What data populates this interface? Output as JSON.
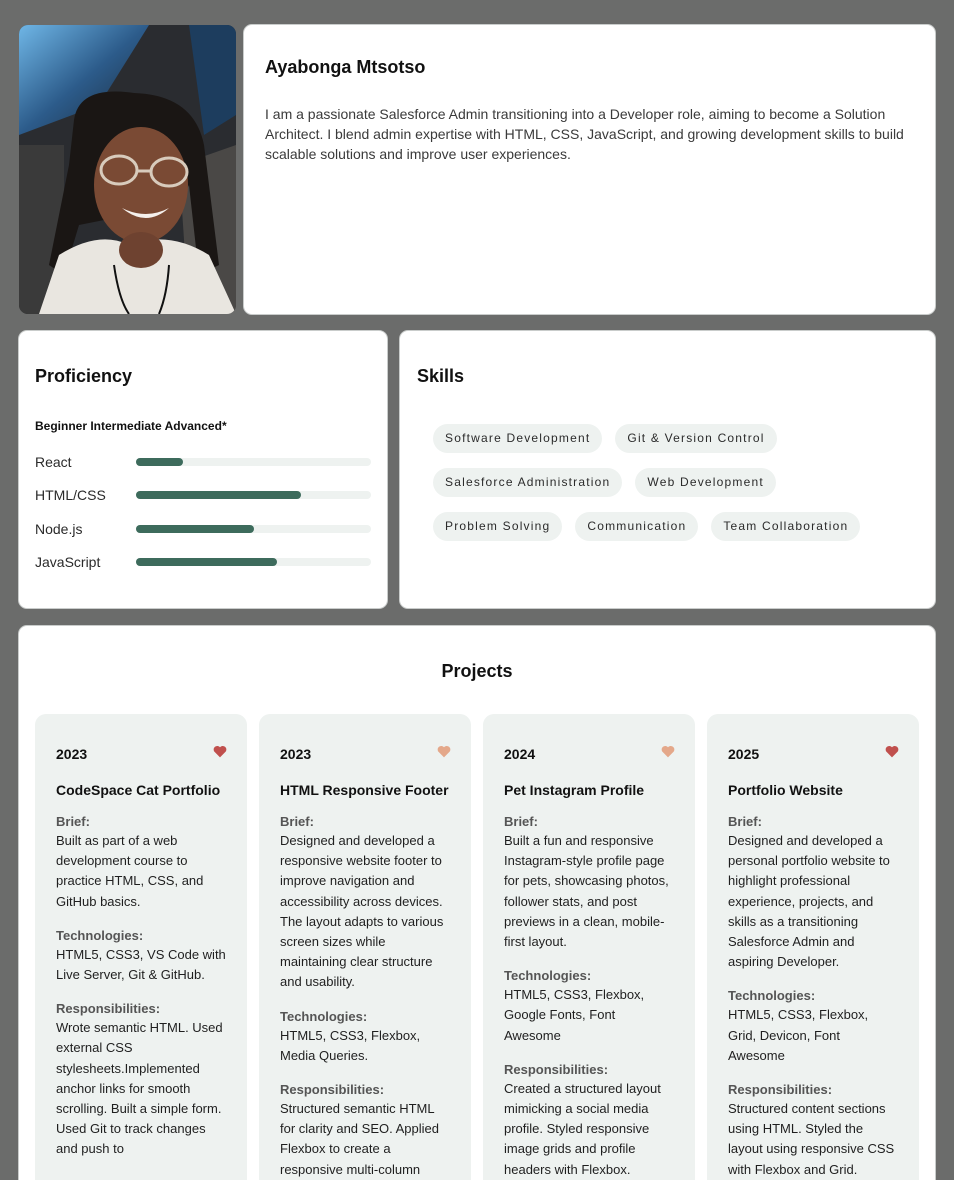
{
  "profile": {
    "name": "Ayabonga Mtsotso",
    "bio": "I am a passionate Salesforce Admin transitioning into a Developer role, aiming to become a Solution Architect. I blend admin expertise with HTML, CSS, JavaScript, and growing development skills to build scalable solutions and improve user experiences."
  },
  "proficiency": {
    "title": "Proficiency",
    "legend": "Beginner Intermediate Advanced*",
    "items": [
      {
        "label": "React",
        "level": 0.2
      },
      {
        "label": "HTML/CSS",
        "level": 0.7
      },
      {
        "label": "Node.js",
        "level": 0.5
      },
      {
        "label": "JavaScript",
        "level": 0.6
      }
    ],
    "bar_color": "#3d6b5c"
  },
  "skills": {
    "title": "Skills",
    "items": [
      "Software Development",
      "Git & Version Control",
      "Salesforce Administration",
      "Web Development",
      "Problem Solving",
      "Communication",
      "Team Collaboration"
    ]
  },
  "projects": {
    "title": "Projects",
    "brief_label": "Brief:",
    "tech_label": "Technologies:",
    "resp_label": "Responsibilities:",
    "items": [
      {
        "year": "2023",
        "heart": "heart-icon",
        "heart_color": "#c0504d",
        "title": "CodeSpace Cat Portfolio",
        "brief": "Built as part of a web development course to practice HTML, CSS, and GitHub basics.",
        "technologies": "HTML5, CSS3, VS Code with Live Server, Git & GitHub.",
        "responsibilities": "Wrote semantic HTML. Used external CSS stylesheets.Implemented anchor links for smooth scrolling. Built a simple form. Used Git to track changes and push to"
      },
      {
        "year": "2023",
        "heart": "heart-icon",
        "heart_color": "#e4a88a",
        "title": "HTML Responsive Footer",
        "brief": "Designed and developed a responsive website footer to improve navigation and accessibility across devices. The layout adapts to various screen sizes while maintaining clear structure and usability.",
        "technologies": "HTML5, CSS3, Flexbox, Media Queries.",
        "responsibilities": "Structured semantic HTML for clarity and SEO. Applied Flexbox to create a responsive multi-column"
      },
      {
        "year": "2024",
        "heart": "heart-icon",
        "heart_color": "#e4a88a",
        "title": "Pet Instagram Profile",
        "brief": "Built a fun and responsive Instagram-style profile page for pets, showcasing photos, follower stats, and post previews in a clean, mobile-first layout.",
        "technologies": "HTML5, CSS3, Flexbox, Google Fonts, Font Awesome",
        "responsibilities": "Created a structured layout mimicking a social media profile. Styled responsive image grids and profile headers with Flexbox."
      },
      {
        "year": "2025",
        "heart": "heart-icon",
        "heart_color": "#c0504d",
        "title": "Portfolio Website",
        "brief": "Designed and developed a personal portfolio website to highlight professional experience, projects, and skills as a transitioning Salesforce Admin and aspiring Developer.",
        "technologies": "HTML5, CSS3, Flexbox, Grid, Devicon, Font Awesome",
        "responsibilities": "Structured content sections using HTML. Styled the layout using responsive CSS with Flexbox and Grid."
      }
    ]
  }
}
